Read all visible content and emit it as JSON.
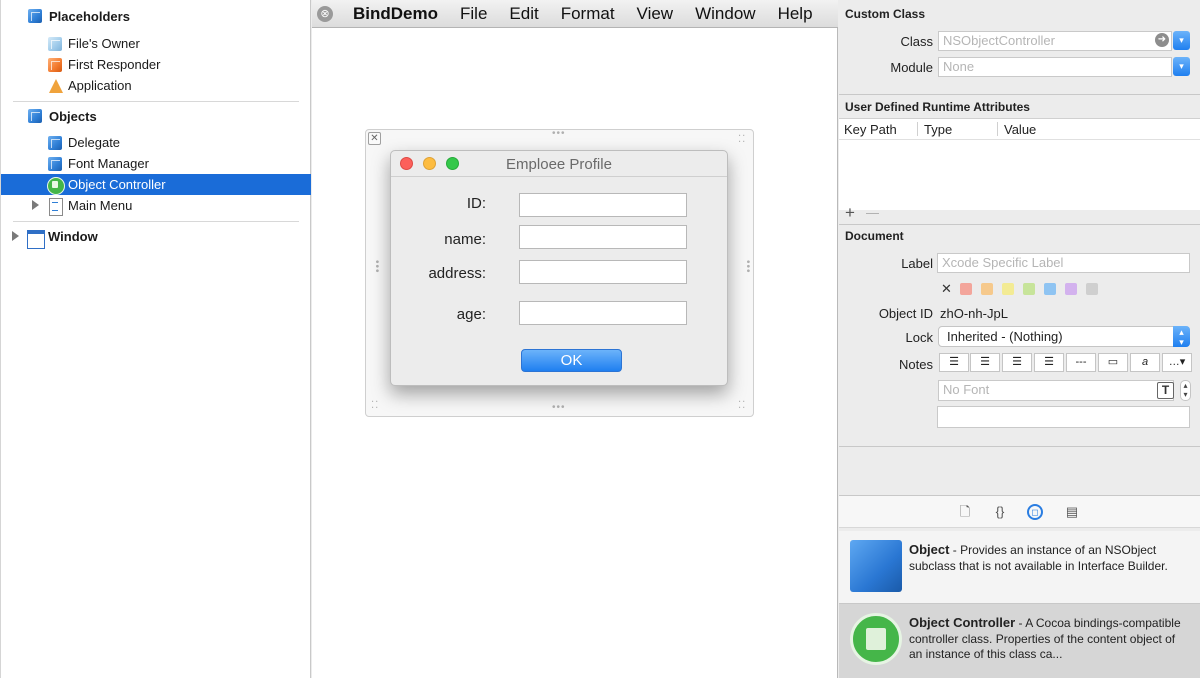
{
  "outline": {
    "placeholders_header": "Placeholders",
    "placeholders": [
      {
        "label": "File's Owner",
        "icon": "light-cube-icon"
      },
      {
        "label": "First Responder",
        "icon": "orange-cube-icon"
      },
      {
        "label": "Application",
        "icon": "application-icon"
      }
    ],
    "objects_header": "Objects",
    "objects": [
      {
        "label": "Delegate",
        "icon": "cube-icon"
      },
      {
        "label": "Font Manager",
        "icon": "cube-icon"
      },
      {
        "label": "Object Controller",
        "icon": "object-controller-icon",
        "selected": true
      },
      {
        "label": "Main Menu",
        "icon": "menu-icon"
      }
    ],
    "window_label": "Window"
  },
  "canvas": {
    "menubar": {
      "close_glyph": "⊗",
      "app": "BindDemo",
      "items": [
        "File",
        "Edit",
        "Format",
        "View",
        "Window",
        "Help"
      ]
    },
    "dialog": {
      "title": "Emploee Profile",
      "fields": [
        {
          "label": "ID:",
          "value": ""
        },
        {
          "label": "name:",
          "value": ""
        },
        {
          "label": "address:",
          "value": ""
        },
        {
          "label": "age:",
          "value": ""
        }
      ],
      "ok_label": "OK"
    }
  },
  "inspector": {
    "custom_class": {
      "header": "Custom Class",
      "class_label": "Class",
      "class_placeholder": "NSObjectController",
      "module_label": "Module",
      "module_placeholder": "None"
    },
    "runtime_attrs": {
      "header": "User Defined Runtime Attributes",
      "columns": [
        "Key Path",
        "Type",
        "Value"
      ],
      "add_glyph": "+",
      "remove_glyph": "—"
    },
    "document": {
      "header": "Document",
      "label_label": "Label",
      "label_placeholder": "Xcode Specific Label",
      "clear_glyph": "✕",
      "swatches": [
        "#f3a59b",
        "#f6c98c",
        "#f3eb94",
        "#c7e49a",
        "#8fc4f2",
        "#d3b2ee",
        "#cfcfcf"
      ],
      "object_id_label": "Object ID",
      "object_id_value": "zhO-nh-JpL",
      "lock_label": "Lock",
      "lock_value": "Inherited - (Nothing)",
      "notes_label": "Notes",
      "font_placeholder": "No Font",
      "font_button": "T"
    },
    "library_tabs": [
      "file-template-icon",
      "code-snippet-icon",
      "object-library-icon",
      "media-library-icon"
    ],
    "library": [
      {
        "name": "Object",
        "desc": " - Provides an instance of an NSObject subclass that is not available in Interface Builder."
      },
      {
        "name": "Object Controller",
        "desc": " - A Cocoa bindings-compatible controller class. Properties of the content object of an instance of this class ca..."
      }
    ]
  },
  "colors": {
    "selection": "#1a6cd8",
    "accent_blue": "#1f7ff0",
    "close_red": "#fc605b",
    "minimize_yellow": "#fdbc40",
    "zoom_green": "#34c84a"
  }
}
